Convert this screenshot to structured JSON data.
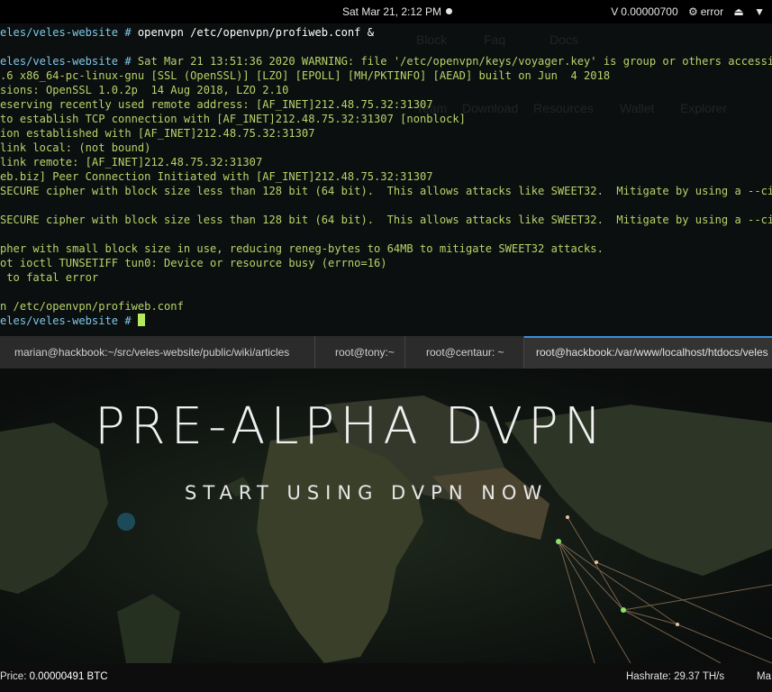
{
  "top_panel": {
    "clock": "Sat Mar 21,  2:12 PM",
    "balance": "0.00000700",
    "network_status": "error"
  },
  "terminal": {
    "prompt_path": "eles/veles-website",
    "lines": [
      {
        "type": "prompt",
        "cmd": "openvpn /etc/openvpn/profiweb.conf &"
      },
      {
        "type": "blank"
      },
      {
        "type": "prompt",
        "cmd": "Sat Mar 21 13:51:36 2020 WARNING: file '/etc/openvpn/keys/voyager.key' is group or others accessible",
        "colored": true
      },
      {
        "type": "out",
        "text": ".6 x86_64-pc-linux-gnu [SSL (OpenSSL)] [LZO] [EPOLL] [MH/PKTINFO] [AEAD] built on Jun  4 2018"
      },
      {
        "type": "out",
        "text": "sions: OpenSSL 1.0.2p  14 Aug 2018, LZO 2.10"
      },
      {
        "type": "out",
        "text": "eserving recently used remote address: [AF_INET]212.48.75.32:31307"
      },
      {
        "type": "out",
        "text": "to establish TCP connection with [AF_INET]212.48.75.32:31307 [nonblock]"
      },
      {
        "type": "out",
        "text": "ion established with [AF_INET]212.48.75.32:31307"
      },
      {
        "type": "out",
        "text": "link local: (not bound)"
      },
      {
        "type": "out",
        "text": "link remote: [AF_INET]212.48.75.32:31307"
      },
      {
        "type": "out",
        "text": "eb.biz] Peer Connection Initiated with [AF_INET]212.48.75.32:31307"
      },
      {
        "type": "out",
        "text": "SECURE cipher with block size less than 128 bit (64 bit).  This allows attacks like SWEET32.  Mitigate by using a --cipher"
      },
      {
        "type": "blank"
      },
      {
        "type": "out",
        "text": "SECURE cipher with block size less than 128 bit (64 bit).  This allows attacks like SWEET32.  Mitigate by using a --cipher"
      },
      {
        "type": "blank"
      },
      {
        "type": "out",
        "text": "pher with small block size in use, reducing reneg-bytes to 64MB to mitigate SWEET32 attacks."
      },
      {
        "type": "out",
        "text": "ot ioctl TUNSETIFF tun0: Device or resource busy (errno=16)"
      },
      {
        "type": "out",
        "text": " to fatal error"
      },
      {
        "type": "blank"
      },
      {
        "type": "out",
        "text": "n /etc/openvpn/profiweb.conf"
      },
      {
        "type": "prompt",
        "cmd": "",
        "cursor": true
      }
    ]
  },
  "ghost_nav": [
    "Block",
    "Faq",
    "Docs",
    "Team",
    "Download",
    "Resources",
    "Wallet",
    "Explorer"
  ],
  "tabs": [
    {
      "label": "marian@hackbook:~/src/veles-website/public/wiki/articles",
      "active": false
    },
    {
      "label": "root@tony:~",
      "active": false
    },
    {
      "label": "root@centaur: ~",
      "active": false
    },
    {
      "label": "root@hackbook:/var/www/localhost/htdocs/veles",
      "active": true
    }
  ],
  "hero": {
    "title": "PRE-ALPHA DVPN",
    "subtitle": "START USING DVPN NOW"
  },
  "footer": {
    "price_label": "Price: ",
    "price_value": "0.00000491 BTC",
    "hashrate_label": "Hashrate: ",
    "hashrate_value": "29.37 TH/s",
    "more": "Ma"
  },
  "colors": {
    "terminal_output": "#b8d36a",
    "prompt_path": "#7ec8e8",
    "cursor": "#b6e85d",
    "tab_active_accent": "#3b8fd6"
  }
}
